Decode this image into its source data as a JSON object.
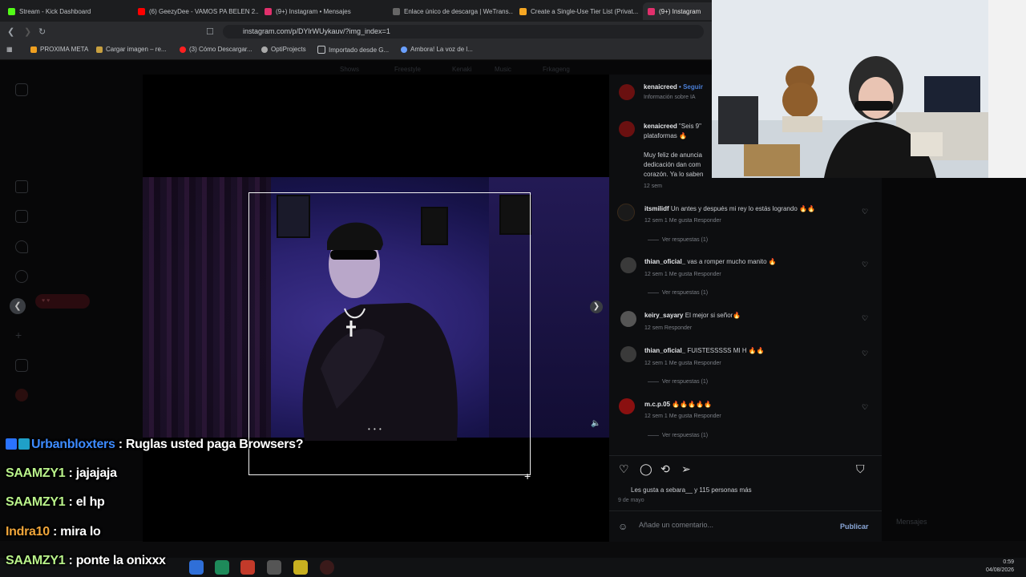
{
  "browser": {
    "tabs": [
      {
        "label": "Stream - Kick Dashboard",
        "color": "#53fc18"
      },
      {
        "label": "(6) GeezyDee - VAMOS PA BELEN 2...",
        "color": "#ff0000"
      },
      {
        "label": "(9+) Instagram • Mensajes",
        "color": "#e1306c"
      },
      {
        "label": "Enlace único de descarga | WeTrans...",
        "color": "#888888"
      },
      {
        "label": "Create a Single-Use Tier List (Privat...",
        "color": "#f5a623"
      },
      {
        "label": "(9+) Instagram",
        "color": "#e1306c"
      }
    ],
    "url": "instagram.com/p/DYlrWUykauv/?img_index=1",
    "bookmarks": [
      {
        "label": "PROXIMA META",
        "color": "#f0a020"
      },
      {
        "label": "Cargar imagen – re...",
        "color": "#c8a040"
      },
      {
        "label": "(3) Cómo Descargar...",
        "color": "#ff2020"
      },
      {
        "label": "OptiProjects",
        "color": "#aaaaaa"
      },
      {
        "label": "Importado desde G...",
        "color": "#c2c5c9"
      },
      {
        "label": "Ambora! La voz de l...",
        "color": "#6aa0ff"
      }
    ]
  },
  "topmenu": [
    "Shows",
    "Freestyle",
    "Kenaki",
    "Music",
    "Frkageng"
  ],
  "post": {
    "author": "kenaicreed",
    "follow": "Seguir",
    "info": "Información sobre IA",
    "caption_user": "kenaicreed",
    "caption_line1": "\"Seis 9\"",
    "caption_line2": "plataformas 🔥",
    "caption_line3": "Muy feliz de anuncia",
    "caption_line4": "dedicación dan com",
    "caption_line5": "corazón. Ya lo saben",
    "caption_time": "12 sem",
    "carousel_dots": "• • •",
    "likes_text": "Les gusta a sebara__ y 115 personas más",
    "date": "9 de mayo",
    "comment_placeholder": "Añade un comentario...",
    "publish": "Publicar",
    "messages": "Mensajes"
  },
  "comments": [
    {
      "user": "itsmilidf",
      "text": "Un antes y después mi rey lo estás logrando 🔥🔥",
      "meta": "12 sem    1 Me gusta    Responder",
      "replies": "Ver respuestas (1)",
      "avatar": "#2a2a2a"
    },
    {
      "user": "thian_oficial_",
      "text": "vas a romper mucho manito 🔥",
      "meta": "12 sem    1 Me gusta    Responder",
      "replies": "Ver respuestas (1)",
      "avatar": "#3a3a3a"
    },
    {
      "user": "keiry_sayary",
      "text": "El mejor si señor🔥",
      "meta": "12 sem    Responder",
      "replies": "",
      "avatar": "#555555"
    },
    {
      "user": "thian_oficial_",
      "text": "FUISTESSSSS MI H 🔥🔥",
      "meta": "12 sem    1 Me gusta    Responder",
      "replies": "Ver respuestas (1)",
      "avatar": "#3a3a3a"
    },
    {
      "user": "m.c.p.05",
      "text": "🔥🔥🔥🔥🔥",
      "meta": "12 sem    1 Me gusta    Responder",
      "replies": "Ver respuestas (1)",
      "avatar": "#8a1010"
    }
  ],
  "chat": [
    {
      "user": "Urbanbloxters",
      "message": "Ruglas usted paga Browsers?",
      "color": "u-blue"
    },
    {
      "user": "SAAMZY1",
      "message": "jajajaja",
      "color": "u-green"
    },
    {
      "user": "SAAMZY1",
      "message": "el hp",
      "color": "u-green"
    },
    {
      "user": "Indra10",
      "message": "mira lo",
      "color": "u-orange"
    },
    {
      "user": "SAAMZY1",
      "message": "ponte la onixxx",
      "color": "u-green"
    }
  ],
  "taskbar": {
    "time": "0:59",
    "date": "04/08/2026"
  }
}
